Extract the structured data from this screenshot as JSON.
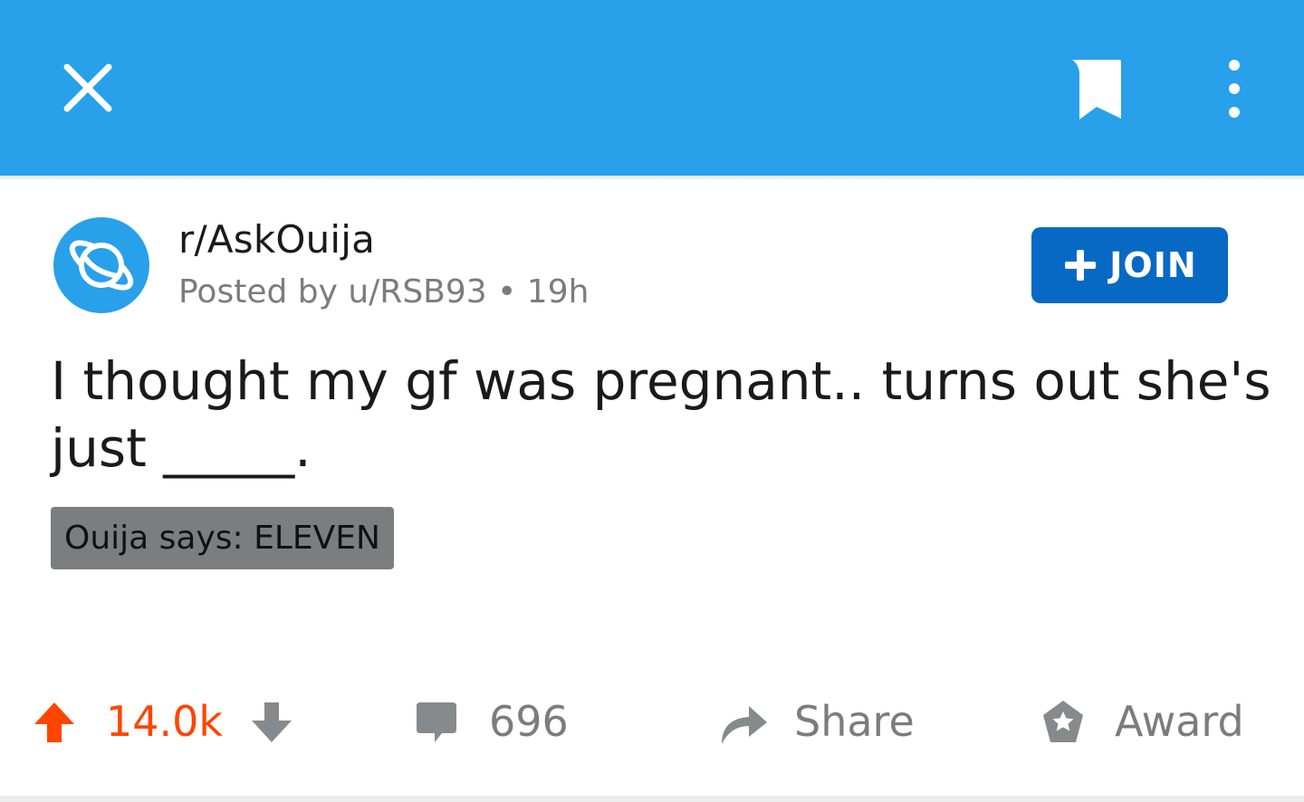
{
  "colors": {
    "header_bg": "#28a0ea",
    "join_bg": "#0869c4",
    "upvote_active": "#ff4500",
    "muted_text": "#7c7c7c",
    "flair_bg": "#7c7d7e"
  },
  "header": {
    "close_icon": "close-icon",
    "bookmark_icon": "bookmark-icon",
    "more_icon": "more-vertical-icon"
  },
  "post": {
    "subreddit": "r/AskOuija",
    "meta": "Posted by u/RSB93 • 19h",
    "join_label": "JOIN",
    "title": "I thought my gf was pregnant.. turns out she's just _____.",
    "flair": "Ouija says: ELEVEN"
  },
  "actions": {
    "score": "14.0k",
    "comments": "696",
    "share_label": "Share",
    "award_label": "Award"
  }
}
